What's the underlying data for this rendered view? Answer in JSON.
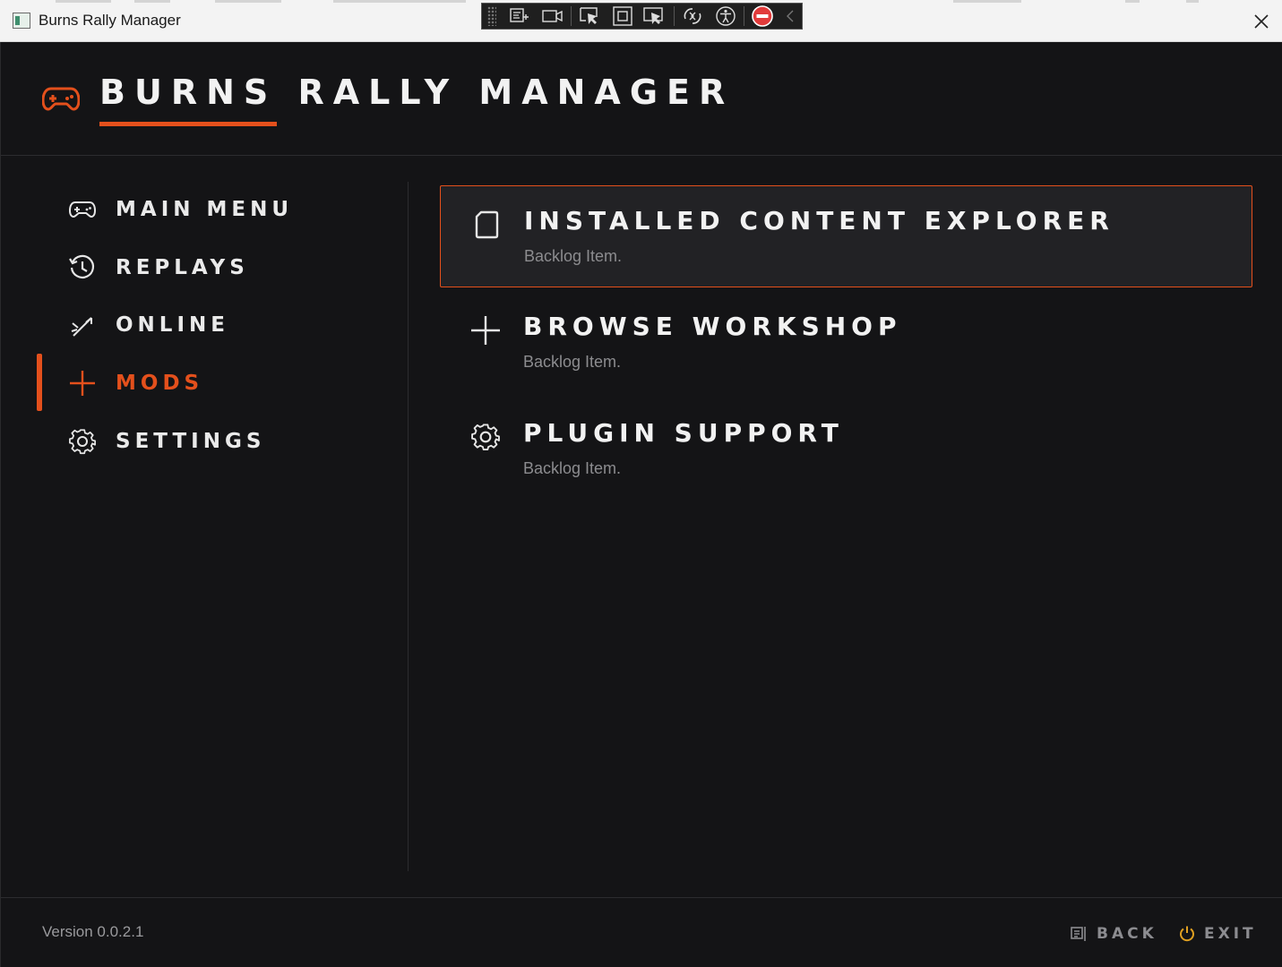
{
  "window": {
    "title": "Burns Rally Manager",
    "close_glyph": "✕"
  },
  "debug_toolbar": {
    "tools": [
      "live-visual-tree-icon",
      "track-focus-icon",
      "select-element-icon",
      "display-layout-adorners-icon",
      "preview-selection-icon",
      "hot-reload-icon",
      "accessibility-icon",
      "stop-icon",
      "collapse-icon"
    ]
  },
  "header": {
    "title": "BURNS RALLY MANAGER",
    "logo_icon": "gamepad-icon"
  },
  "sidebar": {
    "items": [
      {
        "label": "MAIN MENU",
        "icon": "gamepad-icon",
        "active": false
      },
      {
        "label": "REPLAYS",
        "icon": "history-icon",
        "active": false
      },
      {
        "label": "ONLINE",
        "icon": "online-icon",
        "active": false
      },
      {
        "label": "MODS",
        "icon": "plus-icon",
        "active": true
      },
      {
        "label": "SETTINGS",
        "icon": "gear-icon",
        "active": false
      }
    ]
  },
  "content": {
    "cards": [
      {
        "title": "INSTALLED CONTENT EXPLORER",
        "description": "Backlog Item.",
        "icon": "document-icon",
        "selected": true
      },
      {
        "title": "BROWSE WORKSHOP",
        "description": "Backlog Item.",
        "icon": "plus-icon",
        "selected": false
      },
      {
        "title": "PLUGIN SUPPORT",
        "description": "Backlog Item.",
        "icon": "gear-icon",
        "selected": false
      }
    ]
  },
  "footer": {
    "version": "Version 0.0.2.1",
    "back_label": "BACK",
    "exit_label": "EXIT"
  },
  "colors": {
    "accent": "#e4501c",
    "background": "#141416",
    "card_selected_bg": "#222225",
    "exit_icon": "#e0a021"
  }
}
